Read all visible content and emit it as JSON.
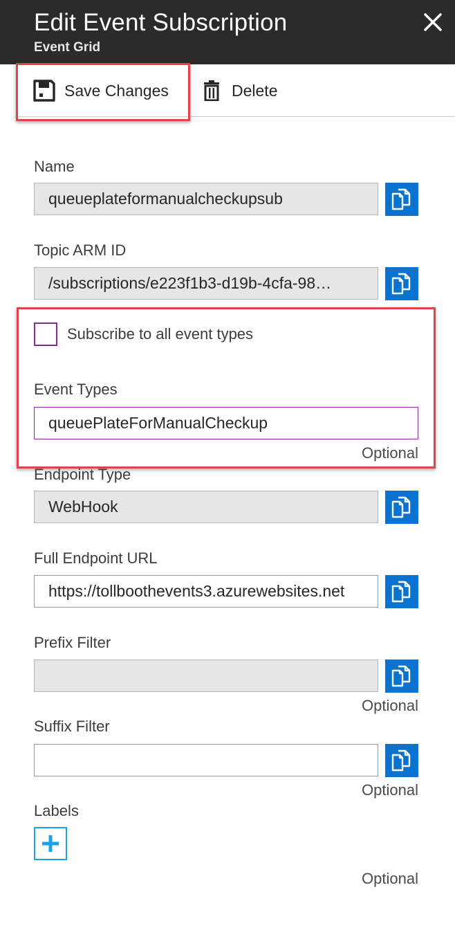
{
  "header": {
    "title": "Edit Event Subscription",
    "subtitle": "Event Grid",
    "close_icon": "close-icon"
  },
  "toolbar": {
    "save_label": "Save Changes",
    "save_icon": "save-icon",
    "delete_label": "Delete",
    "delete_icon": "trash-icon"
  },
  "form": {
    "name": {
      "label": "Name",
      "value": "queueplateformanualcheckupsub"
    },
    "topic_arm_id": {
      "label": "Topic ARM ID",
      "value": "/subscriptions/e223f1b3-d19b-4cfa-98…"
    },
    "subscribe_all": {
      "label": "Subscribe to all event types",
      "checked": false
    },
    "event_types": {
      "label": "Event Types",
      "value": "queuePlateForManualCheckup",
      "hint": "Optional"
    },
    "endpoint_type": {
      "label": "Endpoint Type",
      "value": "WebHook"
    },
    "endpoint_url": {
      "label": "Full Endpoint URL",
      "value": "https://tollboothevents3.azurewebsites.net"
    },
    "prefix_filter": {
      "label": "Prefix Filter",
      "value": "",
      "hint": "Optional"
    },
    "suffix_filter": {
      "label": "Suffix Filter",
      "value": "",
      "hint": "Optional"
    },
    "labels": {
      "label": "Labels",
      "hint": "Optional",
      "add_icon": "plus-icon"
    }
  },
  "colors": {
    "header_bg": "#2b2b2b",
    "copy_button": "#0a73cf",
    "highlight": "#e0434b",
    "checkbox_border": "#8b2a9b",
    "add_border": "#1aa4e8"
  }
}
